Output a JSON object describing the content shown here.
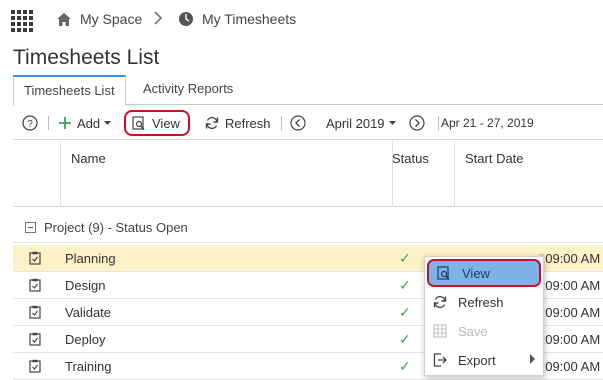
{
  "breadcrumb": {
    "home_label": "My Space",
    "current_label": "My Timesheets"
  },
  "page": {
    "title": "Timesheets List"
  },
  "tabs": [
    {
      "label": "Timesheets List",
      "active": true
    },
    {
      "label": "Activity Reports",
      "active": false
    }
  ],
  "toolbar": {
    "add_label": "Add",
    "view_label": "View",
    "refresh_label": "Refresh",
    "month_label": "April 2019",
    "range_label": "Apr 21 - 27, 2019"
  },
  "grid": {
    "columns": [
      "Name",
      "Status",
      "Start Date"
    ],
    "group_label": "Project (9) - Status Open",
    "rows": [
      {
        "name": "Planning",
        "date_visible": "09:00 AM",
        "selected": true
      },
      {
        "name": "Design",
        "date_visible": "09:00 AM"
      },
      {
        "name": "Validate",
        "date_visible": "09:00 AM"
      },
      {
        "name": "Deploy",
        "date_visible": "09:00 AM"
      },
      {
        "name": "Training",
        "date_visible": "09:00 AM"
      }
    ]
  },
  "context_menu": {
    "items": [
      {
        "label": "View",
        "icon": "view-icon",
        "highlighted": true
      },
      {
        "label": "Refresh",
        "icon": "refresh-icon"
      },
      {
        "label": "Save",
        "icon": "save-icon",
        "disabled": true
      },
      {
        "label": "Export",
        "icon": "export-icon",
        "has_submenu": true
      }
    ]
  },
  "colors": {
    "accent_blue": "#3a8fd6",
    "highlight_red": "#c8102e",
    "selected_row": "#fdf1c8",
    "menu_highlight": "#7fb3e6",
    "check_green": "#3aa64a"
  }
}
